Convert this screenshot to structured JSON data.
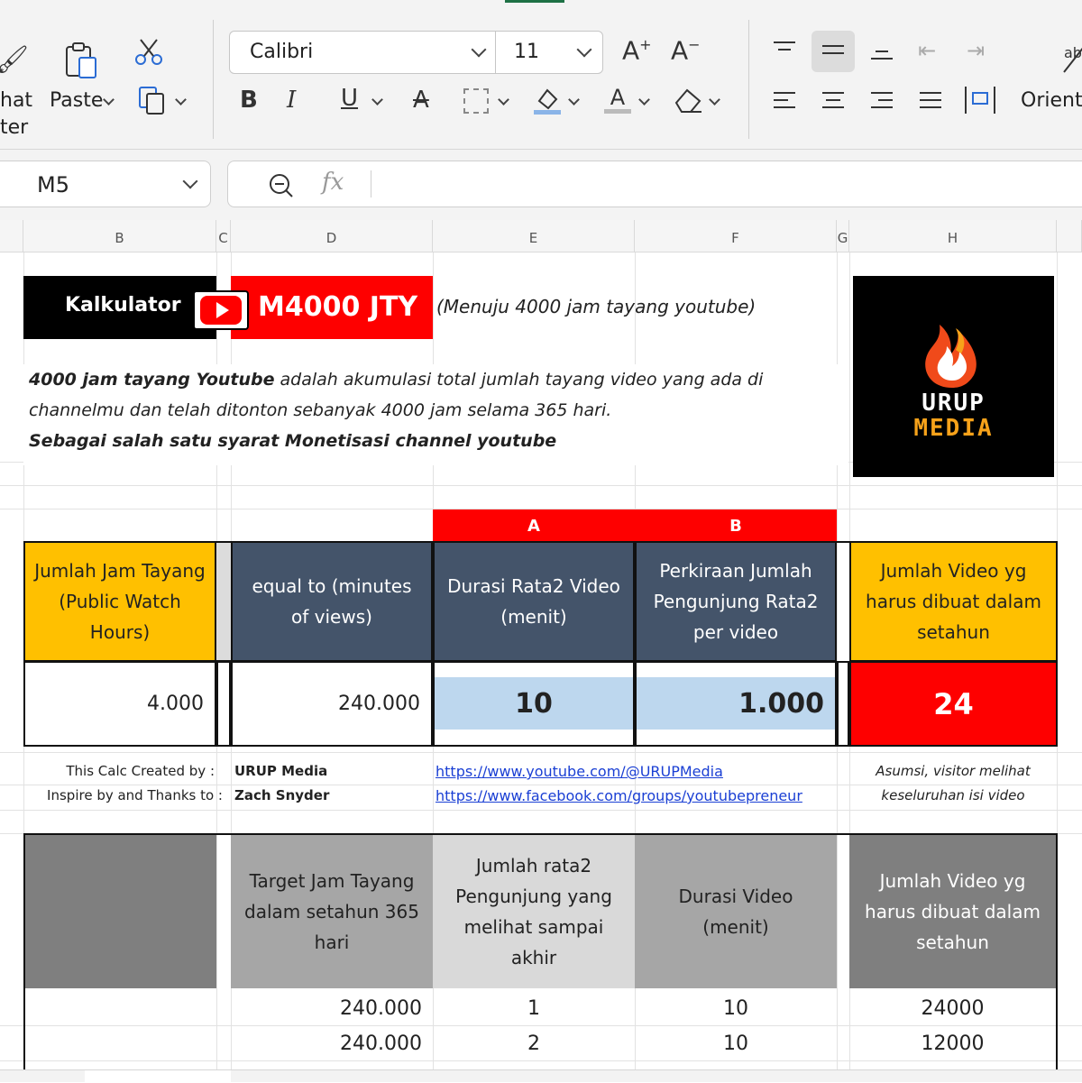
{
  "ribbon": {
    "format_painter_label_1": "hat",
    "format_painter_label_2": "ter",
    "paste_label": "Paste",
    "font_name": "Calibri",
    "font_size": "11",
    "orientation_label": "Orienta"
  },
  "formula_bar": {
    "name_box": "M5",
    "fx_label": "fx",
    "formula": ""
  },
  "columns": [
    "B",
    "C",
    "D",
    "E",
    "F",
    "G",
    "H"
  ],
  "banner": {
    "kalkulator": "Kalkulator",
    "brand": "M4000 JTY",
    "subtitle": "(Menuju 4000 jam tayang youtube)"
  },
  "logo": {
    "line1": "URUP",
    "line2": "MEDIA"
  },
  "description": {
    "line1_bold": "4000 jam tayang Youtube",
    "line1_rest": "  adalah akumulasi total jumlah tayang video yang ada di",
    "line2": "channelmu dan telah ditonton sebanyak 4000 jam selama 365 hari.",
    "line3": "Sebagai salah satu syarat Monetisasi channel youtube"
  },
  "labels_row": {
    "a": "A",
    "b": "B"
  },
  "main_table": {
    "headers": {
      "watch_hours": "Jumlah Jam Tayang (Public Watch Hours)",
      "equal_to": "equal to (minutes of views)",
      "durasi": "Durasi Rata2 Video (menit)",
      "perkiraan": "Perkiraan Jumlah Pengunjung Rata2 per video",
      "jumlah_video": "Jumlah Video yg harus dibuat dalam setahun"
    },
    "values": {
      "watch_hours": "4.000",
      "equal_to": "240.000",
      "durasi": "10",
      "perkiraan": "1.000",
      "jumlah_video": "24"
    }
  },
  "credits": {
    "created_label": "This Calc Created by :",
    "created_value": "URUP Media",
    "created_link": "https://www.youtube.com/@URUPMedia",
    "inspire_label": "Inspire by and Thanks to :",
    "inspire_value": "Zach Snyder",
    "inspire_link": "https://www.facebook.com/groups/youtubepreneur",
    "note_line1": "Asumsi, visitor melihat",
    "note_line2": "keseluruhan isi video"
  },
  "second_table": {
    "headers": {
      "target": "Target Jam Tayang dalam setahun 365 hari",
      "pengunjung": "Jumlah rata2 Pengunjung yang melihat sampai akhir",
      "durasi": "Durasi Video (menit)",
      "jumlah_video": "Jumlah Video yg harus dibuat dalam setahun"
    },
    "rows": [
      {
        "target": "240.000",
        "pengunjung": "1",
        "durasi": "10",
        "jumlah": "24000"
      },
      {
        "target": "240.000",
        "pengunjung": "2",
        "durasi": "10",
        "jumlah": "12000"
      }
    ]
  }
}
